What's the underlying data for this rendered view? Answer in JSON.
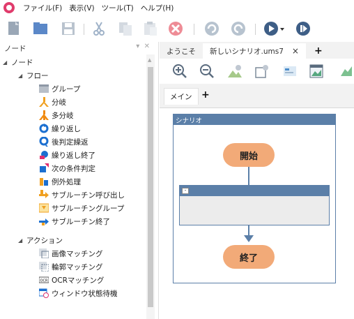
{
  "menubar": {
    "items": [
      "ファイル(F)",
      "表示(V)",
      "ツール(T)",
      "ヘルプ(H)"
    ]
  },
  "left_panel": {
    "title": "ノード",
    "tree": [
      {
        "label": "ノード",
        "icon": "caret-down",
        "kind": "group"
      },
      {
        "label": "フロー",
        "icon": "caret-down",
        "kind": "group"
      },
      {
        "label": "グループ",
        "icon": "group-icon",
        "kind": "item"
      },
      {
        "label": "分岐",
        "icon": "branch-icon",
        "kind": "item"
      },
      {
        "label": "多分岐",
        "icon": "multi-branch-icon",
        "kind": "item"
      },
      {
        "label": "繰り返し",
        "icon": "loop-icon",
        "kind": "item"
      },
      {
        "label": "後判定繰返",
        "icon": "post-loop-icon",
        "kind": "item"
      },
      {
        "label": "繰り返し終了",
        "icon": "loop-end-icon",
        "kind": "item"
      },
      {
        "label": "次の条件判定",
        "icon": "next-condition-icon",
        "kind": "item"
      },
      {
        "label": "例外処理",
        "icon": "exception-icon",
        "kind": "item"
      },
      {
        "label": "サブルーチン呼び出し",
        "icon": "subroutine-call-icon",
        "kind": "item"
      },
      {
        "label": "サブルーチングループ",
        "icon": "subroutine-group-icon",
        "kind": "item"
      },
      {
        "label": "サブルーチン終了",
        "icon": "subroutine-end-icon",
        "kind": "item"
      },
      {
        "label": "アクション",
        "icon": "caret-down",
        "kind": "group"
      },
      {
        "label": "画像マッチング",
        "icon": "image-match-icon",
        "kind": "item"
      },
      {
        "label": "輪郭マッチング",
        "icon": "contour-match-icon",
        "kind": "item"
      },
      {
        "label": "OCRマッチング",
        "icon": "ocr-icon",
        "kind": "item"
      },
      {
        "label": "ウィンドウ状態待機",
        "icon": "window-wait-icon",
        "kind": "item"
      }
    ]
  },
  "tabs": {
    "welcome": "ようこそ",
    "scenario_file": "新しいシナリオ.ums7",
    "close": "×",
    "add": "+"
  },
  "subtabs": {
    "main": "メイン",
    "add": "+"
  },
  "diagram": {
    "scenario_title": "シナリオ",
    "start": "開始",
    "end": "終了",
    "sub_collapse": "-"
  },
  "colors": {
    "accent_blue": "#5b7fa8",
    "node_orange": "#f2aa78",
    "app_icon": "#e03c6c"
  }
}
